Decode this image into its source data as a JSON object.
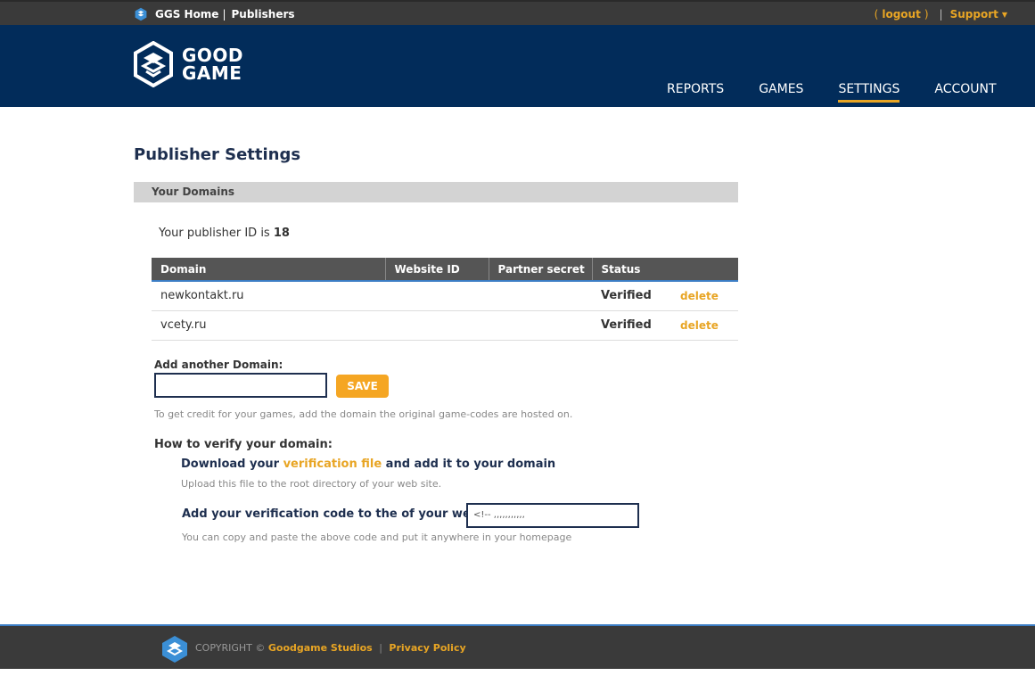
{
  "topbar": {
    "home_label": "GGS Home",
    "separator": "|",
    "publishers_label": "Publishers",
    "open_paren": "(",
    "logout_label": "logout",
    "close_paren": ")",
    "bar": "|",
    "support_label": "Support",
    "support_caret": "▼"
  },
  "brand": {
    "line1": "GOOD",
    "line2": "GAME"
  },
  "nav": {
    "items": [
      {
        "label": "REPORTS"
      },
      {
        "label": "GAMES"
      },
      {
        "label": "SETTINGS",
        "active": true
      },
      {
        "label": "ACCOUNT"
      }
    ]
  },
  "page": {
    "title": "Publisher Settings",
    "section_heading": "Your Domains",
    "publisher_id_text": "Your publisher ID is ",
    "publisher_id_value": "18"
  },
  "table": {
    "headers": [
      "Domain",
      "Website ID",
      "Partner secret",
      "Status"
    ],
    "rows": [
      {
        "domain": "newkontakt.ru",
        "website_id": "",
        "partner_secret": "",
        "status": "Verified",
        "action": "delete"
      },
      {
        "domain": "vcety.ru",
        "website_id": "",
        "partner_secret": "",
        "status": "Verified",
        "action": "delete"
      }
    ]
  },
  "add_domain": {
    "label": "Add another Domain:",
    "input_value": "",
    "save_label": "SAVE",
    "hint": "To get credit for your games, add the domain the original game-codes are hosted on."
  },
  "verify": {
    "heading": "How to verify your domain:",
    "download_prefix": "Download your ",
    "download_link": "verification file",
    "download_suffix": " and add it to your domain",
    "download_hint": "Upload this file to the root directory of your web site.",
    "code_label": "Add your verification code to the of your website",
    "code_value": "<!-- ,,,,,,,,,,,",
    "code_hint": "You can copy and paste the above code and put it anywhere in your homepage"
  },
  "footer": {
    "copyright": "COPYRIGHT ©",
    "company_link": "Goodgame Studios",
    "pipe": "|",
    "privacy_link": "Privacy Policy"
  },
  "colors": {
    "header_bg": "#022c5a",
    "accent": "#e8a524",
    "topbar_bg": "#3a3a3a"
  }
}
